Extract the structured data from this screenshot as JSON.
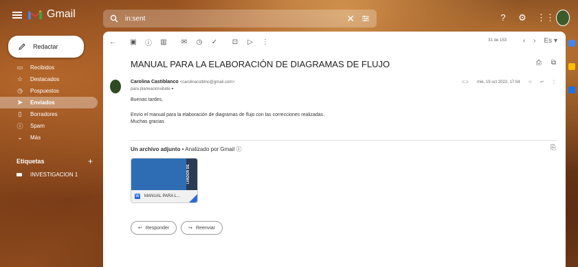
{
  "app": {
    "name": "Gmail"
  },
  "search": {
    "value": "in:sent"
  },
  "compose": {
    "label": "Redactar"
  },
  "nav": [
    {
      "label": "Recibidos",
      "icon": "inbox-icon",
      "glyph": "▭"
    },
    {
      "label": "Destacados",
      "icon": "star-icon",
      "glyph": "☆"
    },
    {
      "label": "Pospuestos",
      "icon": "clock-icon",
      "glyph": "◷"
    },
    {
      "label": "Enviados",
      "icon": "send-icon",
      "glyph": "➤",
      "active": true
    },
    {
      "label": "Borradores",
      "icon": "draft-icon",
      "glyph": "▯"
    },
    {
      "label": "Spam",
      "icon": "spam-icon",
      "glyph": "ⓘ"
    },
    {
      "label": "Más",
      "icon": "chevron-down-icon",
      "glyph": "⌄"
    }
  ],
  "labels": {
    "heading": "Etiquetas",
    "items": [
      {
        "label": "INVESTIGACION 1"
      }
    ]
  },
  "toolbar": {
    "counter": "31 de 153",
    "lang": "Es"
  },
  "email": {
    "subject": "MANUAL PARA LA ELABORACIÓN DE DIAGRAMAS DE FLUJO",
    "sender_name": "Carolina Castiblanco",
    "sender_email": "<carolinacstblnc@gmail.com>",
    "to": "para planeacionubate",
    "date": "mié, 19 oct 2022, 17:04",
    "greeting": "Buenas tardes,",
    "body_line1": "Envío el manual para la elaboración  de diagramas de flujo con las correcciones  realizadas.",
    "body_line2": " Muchas  gracias"
  },
  "attachments": {
    "heading": "Un archivo adjunto",
    "scanned": " • Analizado por Gmail ⓘ",
    "file_name": "MANUAL PARA L...",
    "thumb_text": "LVADOR DE"
  },
  "actions": {
    "reply": "Responder",
    "forward": "Reenviar"
  },
  "colors": {
    "accent": "#2b6bd9",
    "background_theme": "autumn-leaves"
  }
}
